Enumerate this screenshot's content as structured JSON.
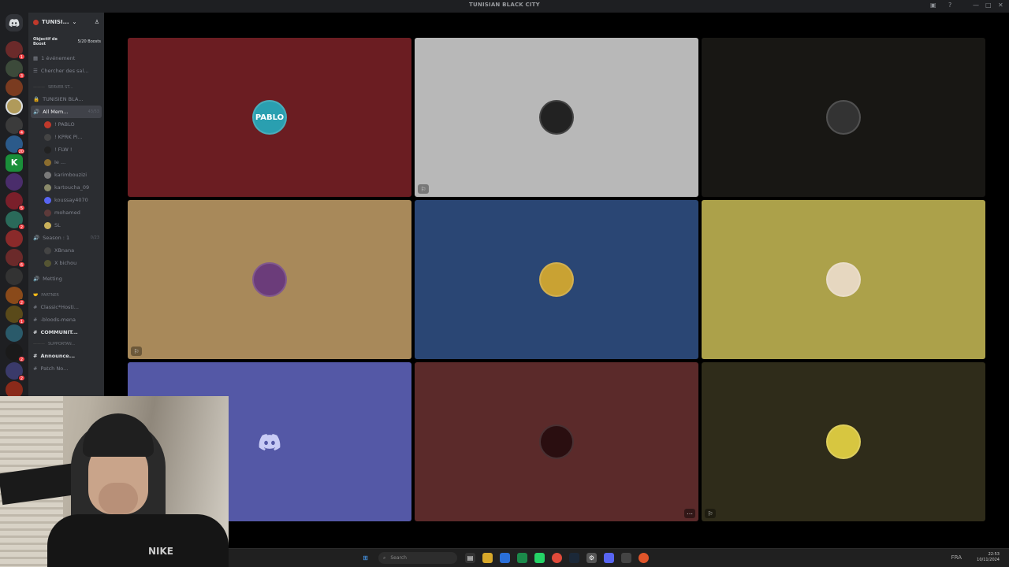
{
  "window": {
    "title": "TUNISIAN BLACK CITY"
  },
  "server": {
    "name": "TUNISI...",
    "boost_goal": "Objectif de Boost",
    "boost_count": "5/20 Boosts"
  },
  "sidebar": {
    "events": "1 événement",
    "search_rooms": "Chercher des sal...",
    "category_server_stats": "SERVER ST...",
    "channel_tunisien": "TUNISIEN BLA...",
    "voice_all_members": {
      "label": "All Mem...",
      "count": "43/53"
    },
    "members": [
      {
        "name": "! PABLO",
        "color": "#c0392b"
      },
      {
        "name": "! KPRK Pi...",
        "color": "#444"
      },
      {
        "name": "! FLW !",
        "color": "#222"
      },
      {
        "name": "Ie ...",
        "color": "#8b6d2f"
      },
      {
        "name": "karimbouzizi",
        "color": "#7a7a7a"
      },
      {
        "name": "kartoucha_09",
        "color": "#8a8a6a"
      },
      {
        "name": "koussay4070",
        "color": "#5865f2"
      },
      {
        "name": "mohamed",
        "color": "#5d3a3a"
      },
      {
        "name": "SL",
        "color": "#c9b05a"
      }
    ],
    "voice_season": {
      "label": "Season : 1",
      "count": "0/23"
    },
    "season_members": [
      {
        "name": "XBnana",
        "color": "#444"
      },
      {
        "name": "X bichou",
        "color": "#553"
      }
    ],
    "voice_meeting": "Metting",
    "category_partner": "partner",
    "text_channels": [
      {
        "label": "Classic*Hosti...",
        "bold": false
      },
      {
        "label": "-bloods-mena",
        "bold": false
      },
      {
        "label": "COMMUNIT...",
        "bold": true
      }
    ],
    "category_support": "SUPPORTAN...",
    "announce": "Announce...",
    "patch": "Patch No..."
  },
  "tiles": [
    {
      "id": "pablo",
      "bg": "#6b1d22",
      "avatar_bg": "#2a9fb0",
      "avatar_text": "PABLO",
      "corner": false,
      "more": false
    },
    {
      "id": "hat",
      "bg": "#b8b8b8",
      "avatar_bg": "#222",
      "avatar_text": "",
      "corner": true,
      "more": false
    },
    {
      "id": "mask",
      "bg": "#181714",
      "avatar_bg": "#333",
      "avatar_text": "",
      "corner": false,
      "more": false
    },
    {
      "id": "cat",
      "bg": "#a8895a",
      "avatar_bg": "#6b3c7a",
      "avatar_text": "",
      "corner": true,
      "more": false
    },
    {
      "id": "player",
      "bg": "#2a4674",
      "avatar_bg": "#c9a233",
      "avatar_text": "",
      "corner": false,
      "more": false
    },
    {
      "id": "beard",
      "bg": "#aca14a",
      "avatar_bg": "#e6d7c0",
      "avatar_text": "",
      "corner": false,
      "more": false
    },
    {
      "id": "discord",
      "bg": "#5458a6",
      "avatar_bg": "transparent",
      "avatar_text": "",
      "corner": false,
      "more": false
    },
    {
      "id": "hood",
      "bg": "#5b2a2a",
      "avatar_bg": "#2a0e10",
      "avatar_text": "",
      "corner": false,
      "more": true
    },
    {
      "id": "yellow",
      "bg": "#2f2c1a",
      "avatar_bg": "#d7c640",
      "avatar_text": "",
      "corner": true,
      "more": false
    }
  ],
  "taskbar": {
    "search_placeholder": "Search",
    "tray": "FRA",
    "time": "22:53",
    "date": "10/11/2024"
  }
}
